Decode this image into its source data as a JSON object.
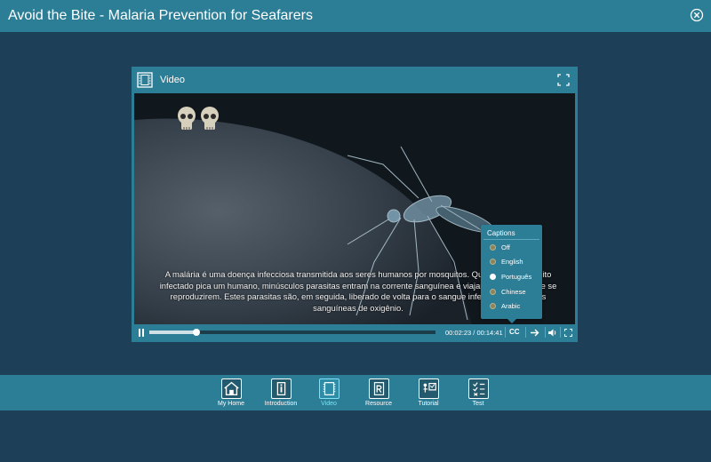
{
  "app": {
    "title": "Avoid the Bite - Malaria Prevention for Seafarers"
  },
  "icons": {
    "close": "close-circle-icon",
    "video": "film-icon",
    "expand": "fullscreen-icon"
  },
  "colors": {
    "background": "#1d4058",
    "panel": "#2c7d96",
    "active": "#7ee3f5"
  },
  "panel": {
    "title": "Video"
  },
  "video": {
    "caption": "A malária é uma doença infecciosa transmitida aos seres humanos por mosquitos. Quando um mosquito infectado pica um humano, minúsculos parasitas entram na corrente sanguínea e viajam para o fígado e se reproduzirem. Estes parasitas são, em seguida, liberado de volta para o sangue infectando as células sanguíneas de oxigênio.",
    "progress": 0.165
  },
  "captions_menu": {
    "title": "Captions",
    "options": [
      {
        "label": "Off",
        "selected": false
      },
      {
        "label": "English",
        "selected": false
      },
      {
        "label": "Português",
        "selected": true
      },
      {
        "label": "Chinese",
        "selected": false
      },
      {
        "label": "Arabic",
        "selected": false
      }
    ]
  },
  "controls": {
    "time": "00:02:23 / 00:14:41",
    "cc_label": "CC"
  },
  "nav": {
    "items": [
      {
        "label": "My Home",
        "icon": "home-icon",
        "active": false
      },
      {
        "label": "Introduction",
        "icon": "info-icon",
        "active": false
      },
      {
        "label": "Video",
        "icon": "film-icon",
        "active": true
      },
      {
        "label": "Resource",
        "icon": "resource-icon",
        "active": false
      },
      {
        "label": "Tutorial",
        "icon": "tutorial-icon",
        "active": false
      },
      {
        "label": "Test",
        "icon": "test-checklist-icon",
        "active": false
      }
    ]
  }
}
